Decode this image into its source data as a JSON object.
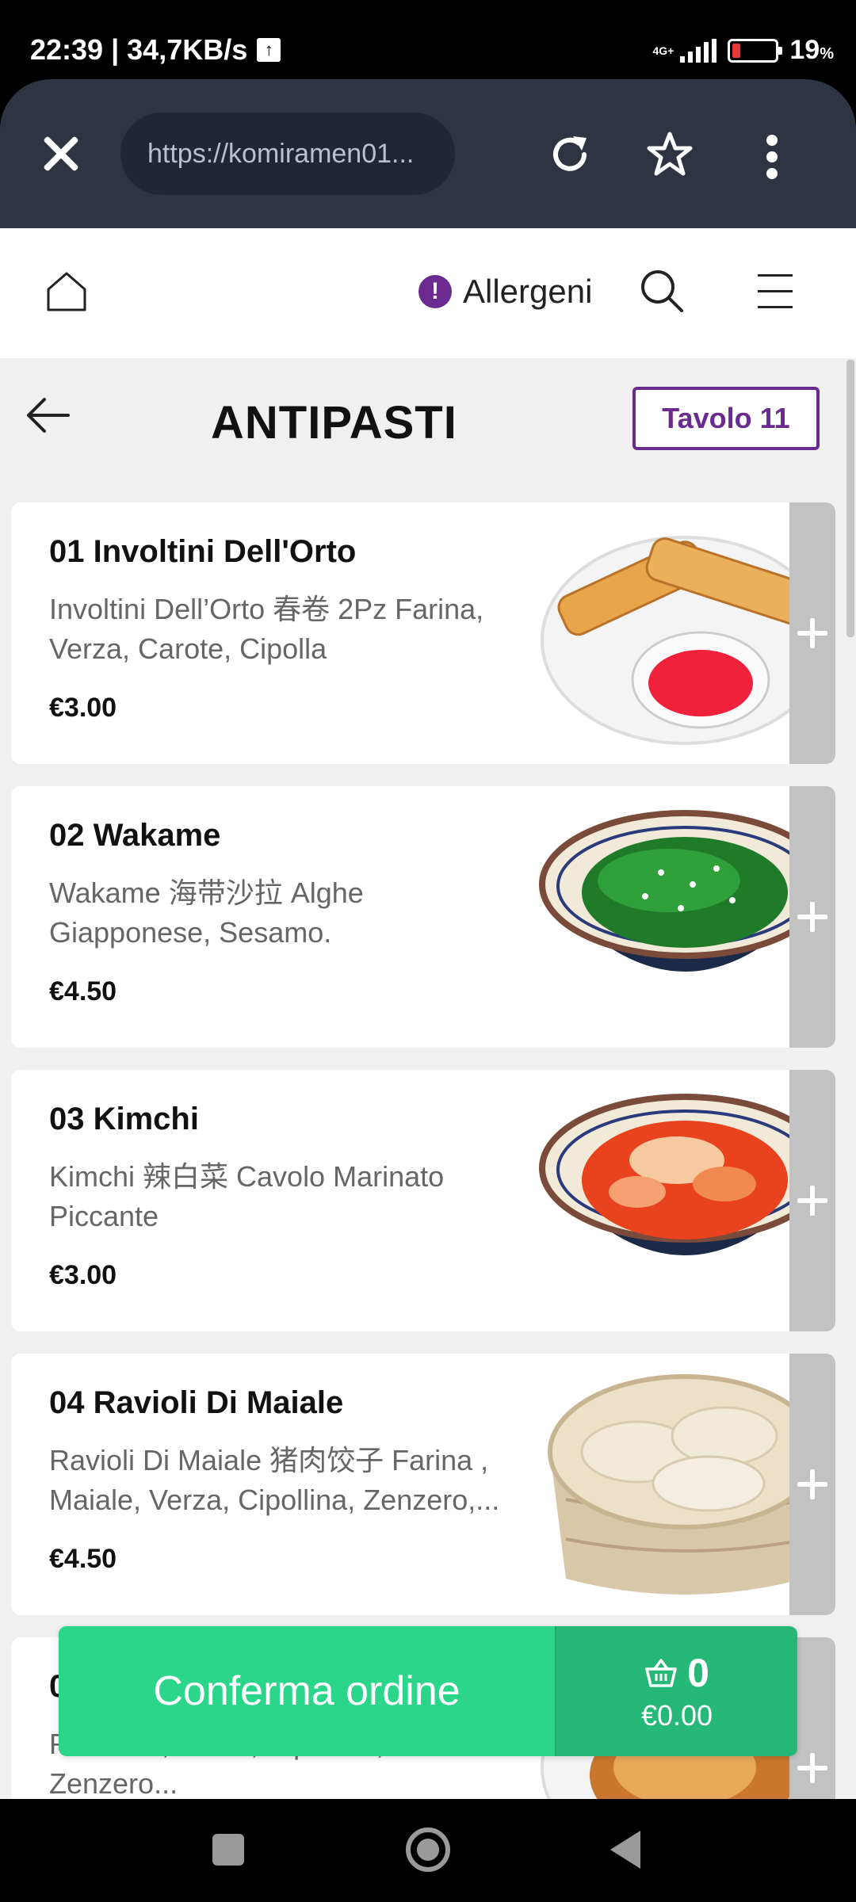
{
  "status_bar": {
    "time_speed": "22:39 | 34,7KB/s",
    "network": "4G+",
    "battery_percent": "19",
    "battery_unit": "%",
    "battery_level": 0.19
  },
  "browser": {
    "url": "https://komiramen01..."
  },
  "header": {
    "allergens_label": "Allergeni",
    "allergens_icon_text": "!"
  },
  "category": {
    "title": "ANTIPASTI",
    "table_label": "Tavolo 11"
  },
  "items": [
    {
      "name": "01 Involtini Dell'Orto",
      "description": "Involtini Dell’Orto 春卷 2Pz Farina, Verza, Carote, Cipolla",
      "price": "€3.00",
      "image": "spring-rolls"
    },
    {
      "name": "02 Wakame",
      "description": "Wakame 海带沙拉 Alghe Giapponese, Sesamo.",
      "price": "€4.50",
      "image": "seaweed-salad"
    },
    {
      "name": "03 Kimchi",
      "description": "Kimchi 辣白菜 Cavolo Marinato Piccante",
      "price": "€3.00",
      "image": "kimchi-bowl"
    },
    {
      "name": "04 Ravioli Di Maiale",
      "description": "Ravioli Di Maiale 猪肉饺子 Farina , Maiale, Verza, Cipollina, Zenzero,...",
      "price": "€4.50",
      "image": "dumplings-steamer"
    },
    {
      "name": "0",
      "description": "R Maiale, Verza, Cipollina, Zenzero...",
      "price": "",
      "image": "fried-dumplings"
    }
  ],
  "order": {
    "confirm_label": "Conferma ordine",
    "cart_count": "0",
    "cart_total": "€0.00"
  },
  "colors": {
    "accent_purple": "#6a2a8f",
    "confirm_green": "#2bd68a",
    "cart_green": "#25b877",
    "browser_bar": "#2f3442"
  }
}
